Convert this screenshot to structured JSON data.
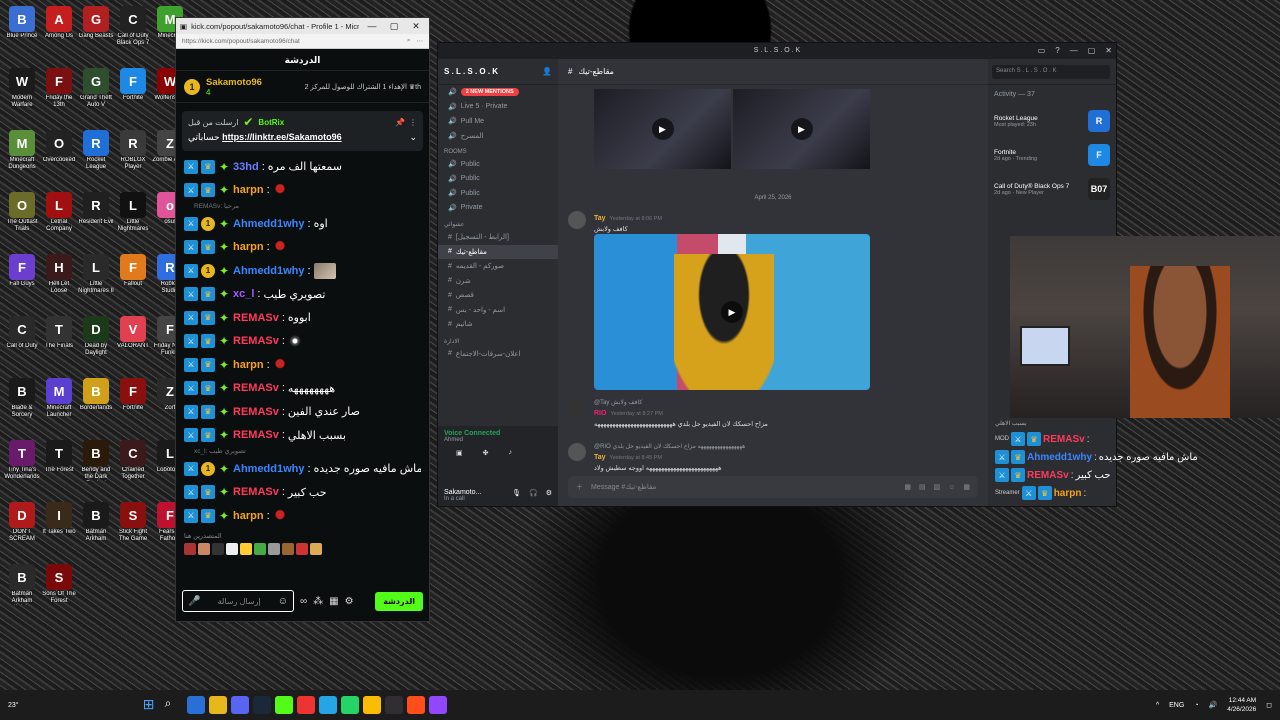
{
  "desktop": {
    "icons": [
      {
        "label": "Blue Prince",
        "color": "#3a6fd1",
        "glyph": "B"
      },
      {
        "label": "Among Us",
        "color": "#c41e1e",
        "glyph": "A"
      },
      {
        "label": "Gang Beasts",
        "color": "#b02020",
        "glyph": "G"
      },
      {
        "label": "Call of Duty Black Ops 7",
        "color": "#222222",
        "glyph": "C"
      },
      {
        "label": "Minecraft",
        "color": "#3fa12d",
        "glyph": "M"
      },
      {
        "label": "Modern Warfare",
        "color": "#1b1b1b",
        "glyph": "W"
      },
      {
        "label": "Friday the 13th",
        "color": "#7a1010",
        "glyph": "F"
      },
      {
        "label": "Grand Theft Auto V",
        "color": "#2e4e2e",
        "glyph": "G"
      },
      {
        "label": "Fortnite",
        "color": "#1e88e5",
        "glyph": "F"
      },
      {
        "label": "Wolfenstein",
        "color": "#8b0000",
        "glyph": "W"
      },
      {
        "label": "Minecraft Dungeons",
        "color": "#5a8f3a",
        "glyph": "M"
      },
      {
        "label": "Overcooked",
        "color": "#222222",
        "glyph": "O"
      },
      {
        "label": "Rocket League",
        "color": "#1f6fd6",
        "glyph": "R"
      },
      {
        "label": "ROBLOX Player",
        "color": "#3a3a3a",
        "glyph": "R"
      },
      {
        "label": "Zombie Army",
        "color": "#444444",
        "glyph": "Z"
      },
      {
        "label": "The Outlast Trials",
        "color": "#6b6b2a",
        "glyph": "O"
      },
      {
        "label": "Lethal Company",
        "color": "#a01010",
        "glyph": "L"
      },
      {
        "label": "Resident Evil",
        "color": "#202020",
        "glyph": "R"
      },
      {
        "label": "Little Nightmares",
        "color": "#111111",
        "glyph": "L"
      },
      {
        "label": "osu!",
        "color": "#e0559a",
        "glyph": "o"
      },
      {
        "label": "Fall Guys",
        "color": "#6a3fd0",
        "glyph": "F"
      },
      {
        "label": "Hell Let Loose",
        "color": "#3a1a1a",
        "glyph": "H"
      },
      {
        "label": "Little Nightmares II",
        "color": "#2a2a2a",
        "glyph": "L"
      },
      {
        "label": "Fallout",
        "color": "#e07a1a",
        "glyph": "F"
      },
      {
        "label": "Roblox Studio",
        "color": "#2f6de0",
        "glyph": "R"
      },
      {
        "label": "Call of Duty",
        "color": "#2a2a2a",
        "glyph": "C"
      },
      {
        "label": "The Finals",
        "color": "#333333",
        "glyph": "T"
      },
      {
        "label": "Dead by Daylight",
        "color": "#1a3a1a",
        "glyph": "D"
      },
      {
        "label": "VALORANT",
        "color": "#e04050",
        "glyph": "V"
      },
      {
        "label": "Friday Night Funkin",
        "color": "#444444",
        "glyph": "F"
      },
      {
        "label": "Blade & Sorcery",
        "color": "#1a1a1a",
        "glyph": "B"
      },
      {
        "label": "Minecraft Launcher",
        "color": "#5a3fd0",
        "glyph": "M"
      },
      {
        "label": "Borderlands",
        "color": "#d0a01a",
        "glyph": "B"
      },
      {
        "label": "Fortnite",
        "color": "#8a1010",
        "glyph": "F"
      },
      {
        "label": "Zort",
        "color": "#2a2a2a",
        "glyph": "Z"
      },
      {
        "label": "Tiny Tina's Wonderlands",
        "color": "#6a1a6a",
        "glyph": "T"
      },
      {
        "label": "The Forest",
        "color": "#1a1a1a",
        "glyph": "T"
      },
      {
        "label": "Bendy and the Dark Revival",
        "color": "#2a1a0a",
        "glyph": "B"
      },
      {
        "label": "Chained Together",
        "color": "#3a1a1a",
        "glyph": "C"
      },
      {
        "label": "Lobotomy",
        "color": "#1a1a1a",
        "glyph": "L"
      },
      {
        "label": "DON'T SCREAM",
        "color": "#b01a1a",
        "glyph": "D"
      },
      {
        "label": "It Takes Two",
        "color": "#3a2a1a",
        "glyph": "I"
      },
      {
        "label": "Batman Arkham",
        "color": "#1a1a1a",
        "glyph": "B"
      },
      {
        "label": "Stick Fight The Game",
        "color": "#8a1010",
        "glyph": "S"
      },
      {
        "label": "Fears to Fathom",
        "color": "#c01030",
        "glyph": "F"
      },
      {
        "label": "Batman Arkham Knight",
        "color": "#2a2a2a",
        "glyph": "B"
      },
      {
        "label": "Sons Of The Forest",
        "color": "#7a0a0a",
        "glyph": "S"
      }
    ]
  },
  "kick": {
    "window_title": "kick.com/popout/sakamoto96/chat - Profile 1 - Micros...",
    "url": "https://kick.com/popout/sakamoto96/chat",
    "header": "الدردشة",
    "streamer": "Sakamoto96",
    "streamer_sub": "4",
    "promo": "الإهداء 1 الشتراك للوصول للمركز 2 ♛th",
    "pinned_author": "ارسلت من قبل",
    "pinned_bot": "BotRix",
    "pinned_prefix": "حساباتي",
    "pinned_link": "https://linktr.ee/Sakamoto96",
    "messages": [
      {
        "reply": "",
        "badges": [
          "mod",
          "crown",
          "star"
        ],
        "user": "33hd",
        "color": "#6b7cff",
        "text": "سمعتها الف مره",
        "emote": ""
      },
      {
        "reply": "",
        "badges": [
          "mod",
          "crown",
          "star"
        ],
        "user": "harpn",
        "color": "#f6a21b",
        "text": "",
        "emote": "red"
      },
      {
        "reply": "REMASv: مرحبا",
        "badges": [
          "mod",
          "coin",
          "star"
        ],
        "user": "Ahmedd1why",
        "color": "#3a86ff",
        "text": "اوه",
        "emote": ""
      },
      {
        "reply": "",
        "badges": [
          "mod",
          "crown",
          "star"
        ],
        "user": "harpn",
        "color": "#f6a21b",
        "text": "",
        "emote": "red"
      },
      {
        "reply": "",
        "badges": [
          "mod",
          "coin",
          "star"
        ],
        "user": "Ahmedd1why",
        "color": "#3a86ff",
        "text": "",
        "emote": "img"
      },
      {
        "reply": "",
        "badges": [
          "mod",
          "crown",
          "star"
        ],
        "user": "xc_l",
        "color": "#a05bff",
        "text": "تصويري طيب",
        "emote": ""
      },
      {
        "reply": "",
        "badges": [
          "mod",
          "crown",
          "star"
        ],
        "user": "REMASv",
        "color": "#ff3b5c",
        "text": "ابووه",
        "emote": ""
      },
      {
        "reply": "",
        "badges": [
          "mod",
          "crown",
          "star"
        ],
        "user": "REMASv",
        "color": "#ff3b5c",
        "text": "",
        "emote": "cat"
      },
      {
        "reply": "",
        "badges": [
          "mod",
          "crown",
          "star"
        ],
        "user": "harpn",
        "color": "#f6a21b",
        "text": "",
        "emote": "red"
      },
      {
        "reply": "",
        "badges": [
          "mod",
          "crown",
          "star"
        ],
        "user": "REMASv",
        "color": "#ff3b5c",
        "text": "ههههههههه",
        "emote": ""
      },
      {
        "reply": "",
        "badges": [
          "mod",
          "crown",
          "star"
        ],
        "user": "REMASv",
        "color": "#ff3b5c",
        "text": "صار عندي الفين",
        "emote": ""
      },
      {
        "reply": "",
        "badges": [
          "mod",
          "crown",
          "star"
        ],
        "user": "REMASv",
        "color": "#ff3b5c",
        "text": "بسبب الاهلي",
        "emote": ""
      },
      {
        "reply": "xc_l: تصويري طيب",
        "badges": [
          "mod",
          "coin",
          "star"
        ],
        "user": "Ahmedd1why",
        "color": "#3a86ff",
        "text": "ماش مافيه صوره جديده",
        "emote": ""
      },
      {
        "reply": "",
        "badges": [
          "mod",
          "crown",
          "star"
        ],
        "user": "REMASv",
        "color": "#ff3b5c",
        "text": "حب كبير",
        "emote": ""
      },
      {
        "reply": "",
        "badges": [
          "mod",
          "crown",
          "star"
        ],
        "user": "harpn",
        "color": "#f6a21b",
        "text": "",
        "emote": "red"
      }
    ],
    "footer_label": "المتصدرين هنا",
    "input_placeholder": "إرسال رسالة",
    "chat_button": "الدردشة"
  },
  "discord": {
    "window_title": "S . L . S . O . K",
    "server_name": "S . L . S . O . K",
    "mentions": "2 NEW MENTIONS",
    "channels_top": [
      "Live 5 · Private",
      "Pull Me",
      "المسرح"
    ],
    "rooms_label": "ROOMS",
    "rooms": [
      "Public",
      "Public",
      "Public",
      "Private"
    ],
    "category2": "عشوائي",
    "text_channels": [
      "[الرابط - التسجيل]",
      "مقاطع-تيك",
      "صوركم - القديمه",
      "شرن",
      "قصص",
      "اسم - واحد - بس",
      "شاتيم"
    ],
    "admin_label": "الادارة",
    "admin_channel": "اعلان-سرفات-الاجتماع",
    "voice_connected": "Voice Connected",
    "voice_sub": "Ahmed",
    "user_name": "Sakamoto...",
    "user_status": "In a call",
    "channel_title": "مقاطع-تيك",
    "date_sep": "April 25, 2026",
    "msg1": {
      "name": "Tay",
      "time": "Yesterday at 8:06 PM",
      "body": "كافف ولابش"
    },
    "msg2": {
      "ref": "@Tay كافف ولابش",
      "name": "RIO",
      "time": "Yesterday at 8:27 PM",
      "body": "مزاح احسكك لان الفيديو حل بلدي ههههههههههههههههههههههههههه"
    },
    "msg3": {
      "ref": "@RIO ههههههههههههههههه مزاح احسكك لان الفيديو حل بلدي",
      "name": "Tay",
      "time": "Yesterday at 8:45 PM",
      "body": "ههههههههههههههههههههههههه اووجه سطيش ولاد"
    },
    "compose_placeholder": "Message #مقاطع-تيك",
    "search_placeholder": "Search S . L . S . O . K",
    "activity_label": "Activity — 37",
    "activities": [
      {
        "title": "Rocket League",
        "sub": "Most played: 23h",
        "color": "#1f6fd6",
        "glyph": "R"
      },
      {
        "title": "Fortnite",
        "sub": "2d ago · Trending",
        "color": "#1e88e5",
        "glyph": "F"
      },
      {
        "title": "Call of Duty® Black Ops 7",
        "sub": "2d ago · New Player",
        "color": "#222222",
        "glyph": "B07"
      }
    ]
  },
  "overlay": {
    "mini_top": "بسبب الاهلي",
    "rows": [
      {
        "badge": "MOD",
        "user": "REMASv",
        "color": "#ff3b5c",
        "text": ""
      },
      {
        "badge": "",
        "user": "Ahmedd1why",
        "color": "#3a86ff",
        "text": "ماش مافيه صوره جديده"
      },
      {
        "badge": "",
        "user": "REMASv",
        "color": "#ff3b5c",
        "text": "حب كبير"
      },
      {
        "badge": "Streamer",
        "user": "harpn",
        "color": "#f6a21b",
        "text": ""
      }
    ]
  },
  "taskbar": {
    "weather": "23°",
    "lang": "ENG",
    "time": "12:44 AM",
    "date": "4/26/2026"
  }
}
